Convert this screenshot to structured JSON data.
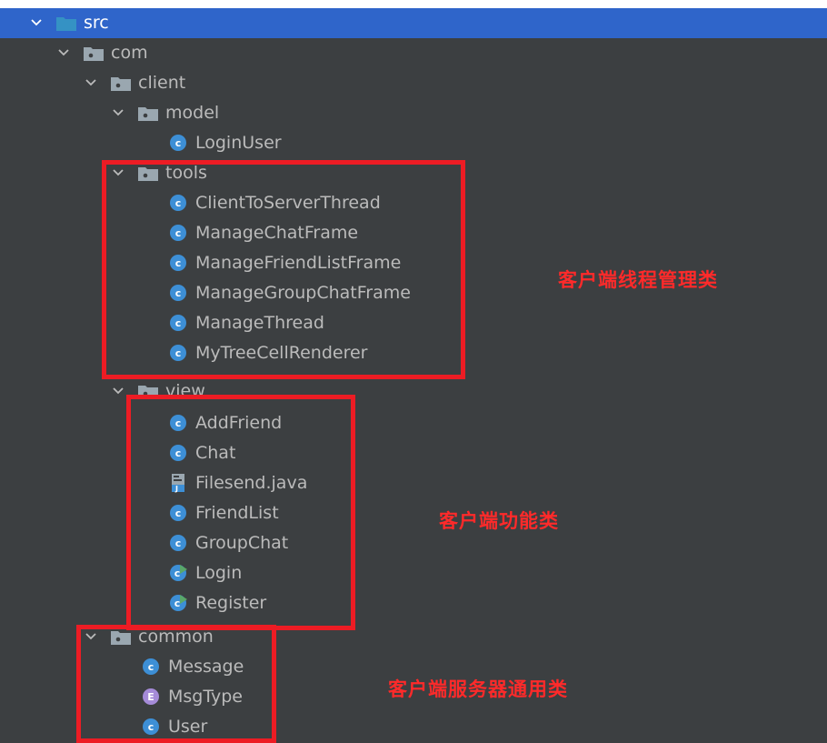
{
  "tree": {
    "src": "src",
    "com": "com",
    "client": "client",
    "model": "model",
    "model_items": [
      "LoginUser"
    ],
    "tools": "tools",
    "tools_items": [
      "ClientToServerThread",
      "ManageChatFrame",
      "ManageFriendListFrame",
      "ManageGroupChatFrame",
      "ManageThread",
      "MyTreeCellRenderer"
    ],
    "view": "view",
    "view_items": [
      "AddFriend",
      "Chat",
      "Filesend.java",
      "FriendList",
      "GroupChat",
      "Login",
      "Register"
    ],
    "common": "common",
    "common_items": [
      "Message",
      "MsgType",
      "User"
    ]
  },
  "annotations": {
    "tools_note": "客户端线程管理类",
    "view_note": "客户端功能类",
    "common_note": "客户端服务器通用类"
  },
  "colors": {
    "background": "#3c3f41",
    "selection": "#2f65ca",
    "class_icon": "#3d8fd6",
    "enum_icon": "#a58bd8",
    "annotation_red": "#ed1c24"
  },
  "icons": {
    "expanded": "chevron-down-icon",
    "src_folder": "source-folder-icon",
    "package": "package-folder-icon",
    "class": "java-class-icon",
    "enum": "java-enum-icon",
    "main_class": "runnable-class-icon",
    "java_file": "java-file-icon"
  }
}
